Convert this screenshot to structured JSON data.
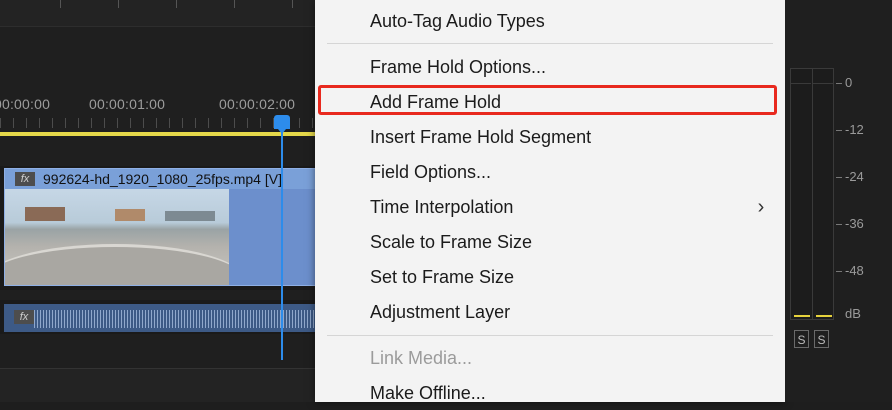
{
  "timeline": {
    "timecodes": [
      "00:00:00",
      "00:00:01:00",
      "00:00:02:00"
    ],
    "video_clip_name": "992624-hd_1920_1080_25fps.mp4 [V]",
    "fx_label": "fx"
  },
  "context_menu": {
    "items": [
      {
        "label": "Auto-Tag Audio Types",
        "enabled": true
      },
      {
        "label": "Frame Hold Options...",
        "enabled": true
      },
      {
        "label": "Add Frame Hold",
        "enabled": true,
        "highlighted": true
      },
      {
        "label": "Insert Frame Hold Segment",
        "enabled": true
      },
      {
        "label": "Field Options...",
        "enabled": true
      },
      {
        "label": "Time Interpolation",
        "enabled": true,
        "has_submenu": true
      },
      {
        "label": "Scale to Frame Size",
        "enabled": true
      },
      {
        "label": "Set to Frame Size",
        "enabled": true
      },
      {
        "label": "Adjustment Layer",
        "enabled": true
      },
      {
        "label": "Link Media...",
        "enabled": false
      },
      {
        "label": "Make Offline...",
        "enabled": true
      }
    ],
    "submenu_arrow": "›",
    "highlight_color": "#e8291e"
  },
  "audio_meter": {
    "scale": [
      "0",
      "-12",
      "-24",
      "-36",
      "-48",
      "dB"
    ],
    "solo_buttons": [
      "S",
      "S"
    ]
  },
  "colors": {
    "playhead": "#2d8ceb",
    "work_area": "#e5d84a",
    "video_clip": "#6c8fcc",
    "audio_clip": "#3d5a86",
    "menu_bg": "#f3f3f3"
  }
}
